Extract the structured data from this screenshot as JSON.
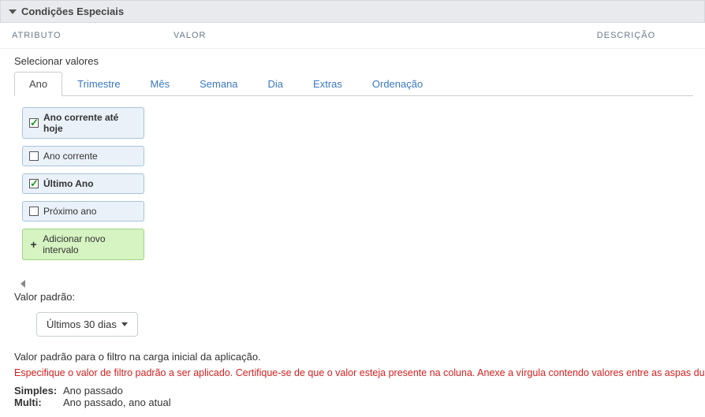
{
  "panel": {
    "title": "Condições Especiais"
  },
  "columns": {
    "attr": "ATRIBUTO",
    "value": "VALOR",
    "desc": "DESCRIÇÃO"
  },
  "selectLabel": "Selecionar valores",
  "tabs": {
    "ano": "Ano",
    "trimestre": "Trimestre",
    "mes": "Mês",
    "semana": "Semana",
    "dia": "Dia",
    "extras": "Extras",
    "ordenacao": "Ordenação"
  },
  "options": {
    "anoCorrenteHoje": "Ano corrente até hoje",
    "anoCorrente": "Ano corrente",
    "ultimoAno": "Último Ano",
    "proximoAno": "Próximo ano",
    "addIntervalo": "Adicionar novo intervalo"
  },
  "defaultValue": {
    "label": "Valor padrão:",
    "selected": "Últimos 30 dias",
    "desc": "Valor padrão para o filtro na carga inicial da aplicação.",
    "warning": "Especifique o valor de filtro padrão a ser aplicado. Certifique-se de que o valor esteja presente na coluna. Anexe a vírgula contendo valores entre as aspas duplas.",
    "simplesKey": "Simples:",
    "simplesVal": "Ano passado",
    "multiKey": "Multi:",
    "multiVal": "Ano passado, ano atual"
  }
}
